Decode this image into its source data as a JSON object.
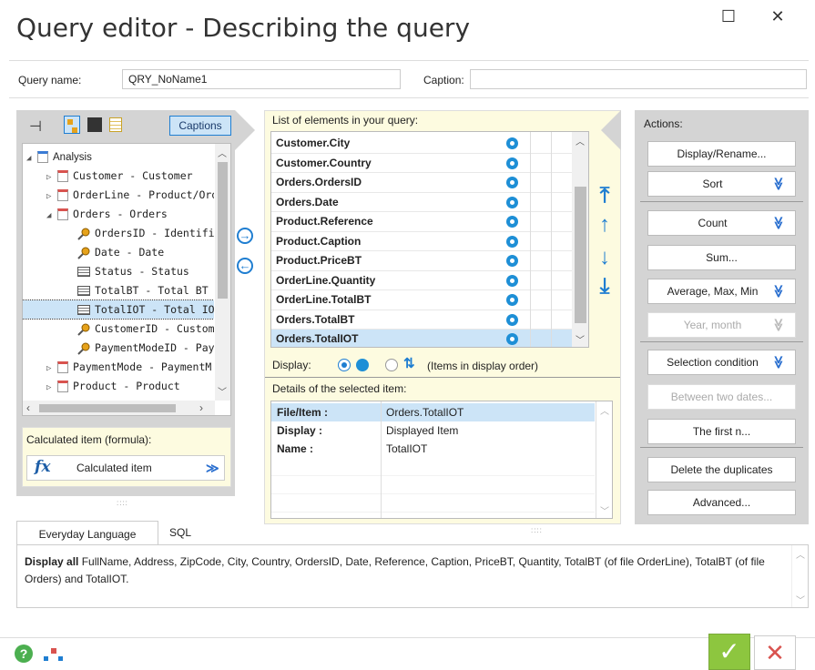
{
  "window": {
    "title": "Query editor - Describing the query",
    "maximize_glyph": "☐",
    "close_glyph": "✕"
  },
  "query": {
    "name_label": "Query name:",
    "name_value": "QRY_NoName1",
    "caption_label": "Caption:",
    "caption_value": ""
  },
  "left_panel": {
    "captions_button": "Captions",
    "tree": [
      {
        "label": "Analysis",
        "icon": "analysis-icon",
        "level": 0
      },
      {
        "label": "Customer - Customer",
        "icon": "table-icon",
        "level": 1
      },
      {
        "label": "OrderLine - Product/Ord",
        "icon": "table-icon",
        "level": 1
      },
      {
        "label": "Orders - Orders",
        "icon": "table-icon",
        "level": 1
      },
      {
        "label": "OrdersID - Identifier",
        "icon": "key-icon",
        "level": 2
      },
      {
        "label": "Date - Date",
        "icon": "key-icon",
        "level": 2
      },
      {
        "label": "Status - Status",
        "icon": "field-icon",
        "level": 2
      },
      {
        "label": "TotalBT - Total BT",
        "icon": "field-icon",
        "level": 2
      },
      {
        "label": "TotalIOT - Total IOT",
        "icon": "field-icon",
        "level": 2
      },
      {
        "label": "CustomerID - Custom",
        "icon": "key-icon",
        "level": 2
      },
      {
        "label": "PaymentModeID - Pay",
        "icon": "key-icon",
        "level": 2
      },
      {
        "label": "PaymentMode - PaymentM",
        "icon": "table-icon",
        "level": 1
      },
      {
        "label": "Product - Product",
        "icon": "table-icon",
        "level": 1
      }
    ],
    "calc_label": "Calculated item (formula):",
    "calc_button": "Calculated item"
  },
  "middle_panel": {
    "list_title": "List of elements in your query:",
    "items": [
      "Customer.City",
      "Customer.Country",
      "Orders.OrdersID",
      "Orders.Date",
      "Product.Reference",
      "Product.Caption",
      "Product.PriceBT",
      "OrderLine.Quantity",
      "OrderLine.TotalBT",
      "Orders.TotalBT",
      "Orders.TotalIOT"
    ],
    "display_label": "Display:",
    "display_order_text": "(Items in display order)",
    "details_title": "Details of the selected item:",
    "details": [
      {
        "key": "File/Item :",
        "value": "Orders.TotalIOT"
      },
      {
        "key": "Display :",
        "value": "Displayed Item"
      },
      {
        "key": "Name :",
        "value": "TotalIOT"
      }
    ]
  },
  "actions": {
    "title": "Actions:",
    "buttons": [
      {
        "label": "Display/Rename...",
        "chevron": false,
        "disabled": false
      },
      {
        "label": "Sort",
        "chevron": true,
        "disabled": false
      },
      {
        "label": "Count",
        "chevron": true,
        "disabled": false
      },
      {
        "label": "Sum...",
        "chevron": false,
        "disabled": false
      },
      {
        "label": "Average, Max, Min",
        "chevron": true,
        "disabled": false
      },
      {
        "label": "Year, month",
        "chevron": true,
        "disabled": true
      },
      {
        "label": "Selection condition",
        "chevron": true,
        "disabled": false
      },
      {
        "label": "Between two dates...",
        "chevron": false,
        "disabled": true
      },
      {
        "label": "The first n...",
        "chevron": false,
        "disabled": false
      },
      {
        "label": "Delete the duplicates",
        "chevron": false,
        "disabled": false
      },
      {
        "label": "Advanced...",
        "chevron": false,
        "disabled": false
      }
    ]
  },
  "bottom": {
    "tabs": [
      "Everyday Language",
      "SQL"
    ],
    "description_bold": "Display all",
    "description": " FullName, Address, ZipCode, City, Country, OrdersID, Date, Reference, Caption, PriceBT, Quantity, TotalBT (of file OrderLine), TotalBT (of file Orders) and TotalIOT."
  },
  "colors": {
    "accent": "#1f7ed1",
    "selection": "#cce4f7",
    "ok_green": "#8dc63f",
    "cancel_red": "#d9534f"
  }
}
